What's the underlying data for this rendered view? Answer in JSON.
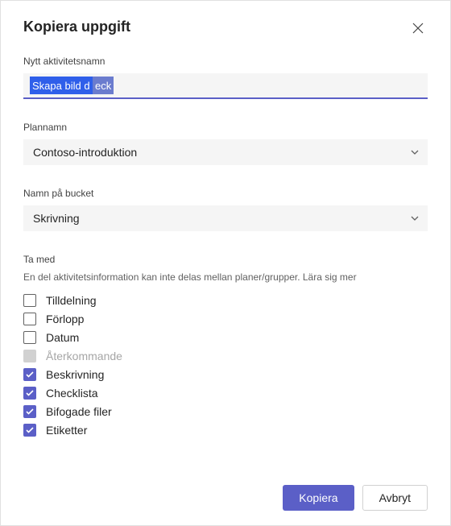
{
  "dialog": {
    "title": "Kopiera uppgift"
  },
  "name_field": {
    "label": "Nytt aktivitetsnamn",
    "value_selected": "Skapa bild d",
    "value_rest": "eck"
  },
  "plan_field": {
    "label": "Plannamn",
    "value": "Contoso-introduktion"
  },
  "bucket_field": {
    "label": "Namn på bucket",
    "value": "Skrivning"
  },
  "include": {
    "label": "Ta med",
    "description_text": "En del aktivitetsinformation kan inte delas mellan planer/grupper. ",
    "description_link": "Lära sig mer",
    "items": [
      {
        "label": "Tilldelning",
        "checked": false,
        "disabled": false
      },
      {
        "label": "Förlopp",
        "checked": false,
        "disabled": false
      },
      {
        "label": "Datum",
        "checked": false,
        "disabled": false
      },
      {
        "label": "Återkommande",
        "checked": false,
        "disabled": true
      },
      {
        "label": "Beskrivning",
        "checked": true,
        "disabled": false
      },
      {
        "label": "Checklista",
        "checked": true,
        "disabled": false
      },
      {
        "label": "Bifogade filer",
        "checked": true,
        "disabled": false
      },
      {
        "label": "Etiketter",
        "checked": true,
        "disabled": false
      }
    ]
  },
  "footer": {
    "primary": "Kopiera",
    "secondary": "Avbryt"
  }
}
